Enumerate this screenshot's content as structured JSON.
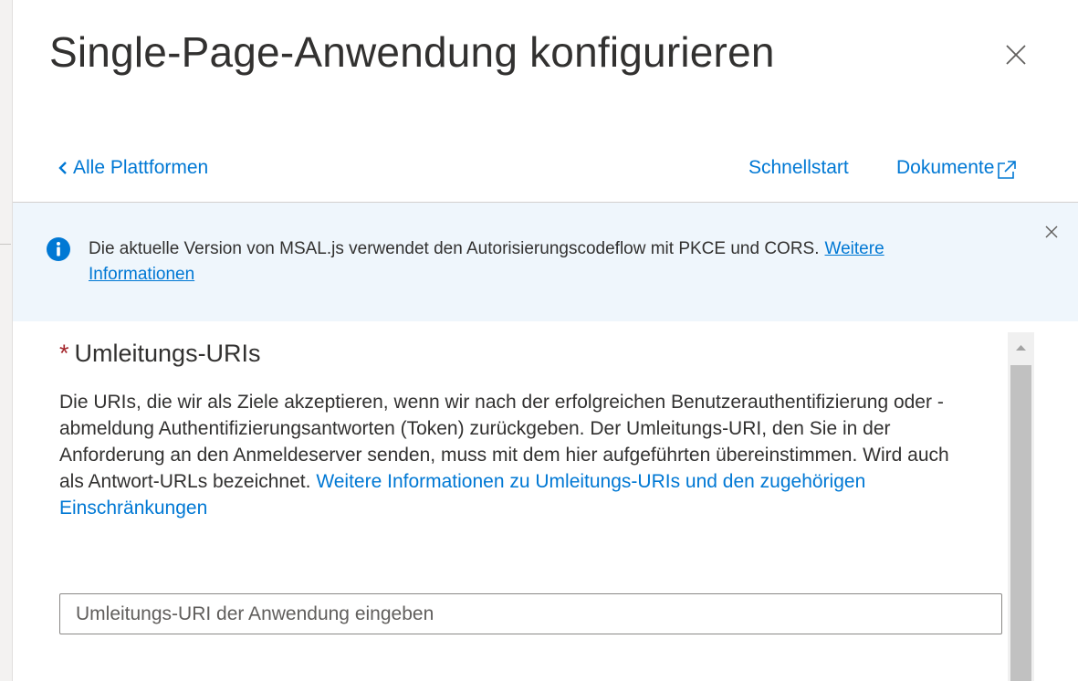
{
  "panel": {
    "title": "Single-Page-Anwendung konfigurieren"
  },
  "nav": {
    "back_label": "Alle Plattformen",
    "quickstart_label": "Schnellstart",
    "docs_label": "Dokumente"
  },
  "info_bar": {
    "message": "Die aktuelle Version von MSAL.js verwendet den Autorisierungscodeflow mit PKCE und CORS.",
    "link_label": "Weitere Informationen"
  },
  "redirect_section": {
    "required_marker": "*",
    "title": "Umleitungs-URIs",
    "description": "Die URIs, die wir als Ziele akzeptieren, wenn wir nach der erfolgreichen Benutzerauthentifizierung oder -abmeldung Authentifizierungsantworten (Token) zurückgeben. Der Umleitungs-URI, den Sie in der Anforderung an den Anmeldeserver senden, muss mit dem hier aufgeführten übereinstimmen. Wird auch als Antwort-URLs bezeichnet.",
    "link_label": "Weitere Informationen zu Umleitungs-URIs und den zugehörigen Einschränkungen",
    "input_value": "",
    "input_placeholder": "Umleitungs-URI der Anwendung eingeben"
  },
  "icons": {
    "close": "close-icon",
    "back": "chevron-left-icon",
    "external": "external-link-icon",
    "info": "info-icon",
    "scroll_up": "scroll-up-arrow-icon"
  },
  "colors": {
    "accent": "#0078d4",
    "info_background": "#eff6fc",
    "required": "#a4262c",
    "text": "#323130"
  }
}
